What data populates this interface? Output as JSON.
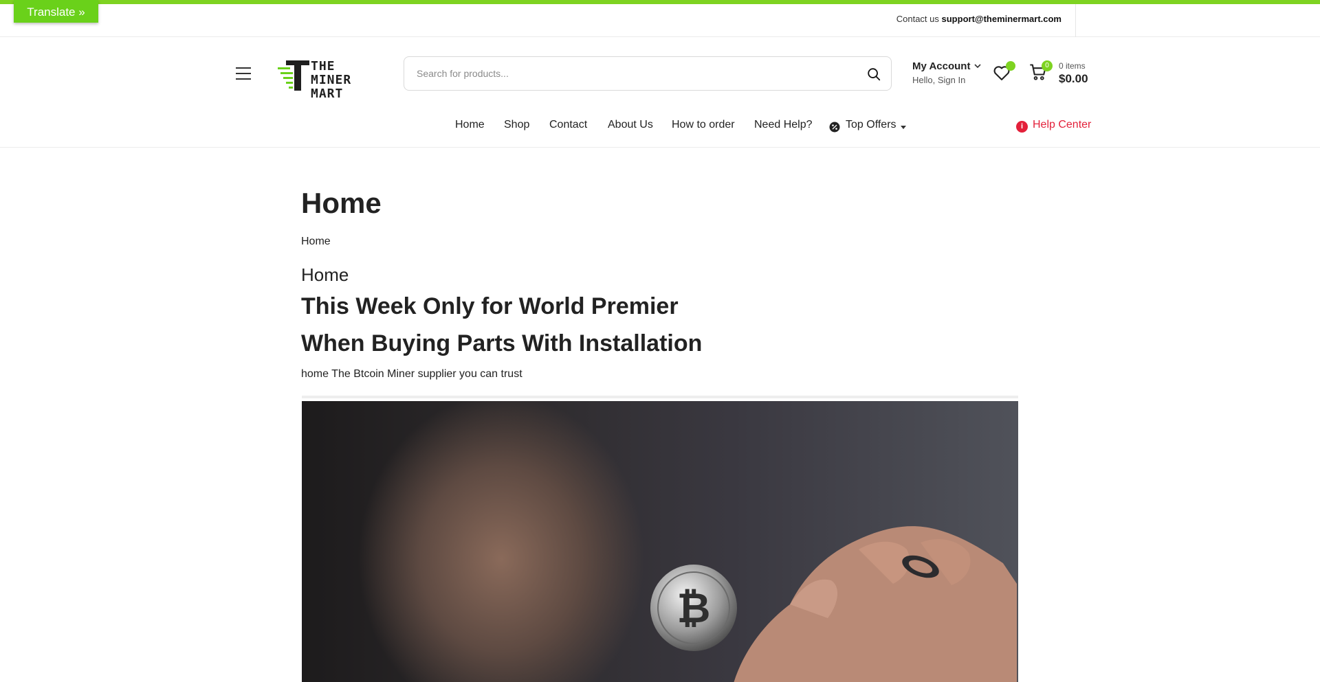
{
  "translate": {
    "label": "Translate »"
  },
  "topbar": {
    "contact_prefix": "Contact us",
    "contact_email": "support@theminermart.com"
  },
  "header": {
    "logo_text_line1": "THE MINER",
    "logo_text_line2": "MART",
    "search_placeholder": "Search for products...",
    "account_label": "My Account",
    "account_sub": "Hello, Sign In",
    "cart_count": "0",
    "cart_items": "0 items",
    "cart_total": "$0.00"
  },
  "nav": {
    "items": [
      {
        "label": "Home"
      },
      {
        "label": "Shop"
      },
      {
        "label": "Contact"
      },
      {
        "label": "About Us"
      },
      {
        "label": "How to order"
      },
      {
        "label": "Need Help?"
      },
      {
        "label": "Top Offers"
      }
    ],
    "help_label": "Help Center"
  },
  "content": {
    "page_title": "Home",
    "breadcrumb": "Home",
    "section_title": "Home",
    "promo_line1": "This Week Only for World Premier",
    "promo_line2": "When Buying Parts With Installation",
    "tagline": "home The Btcoin Miner supplier you can trust"
  },
  "colors": {
    "accent": "#7ed321",
    "help": "#e3203a",
    "text": "#222222"
  }
}
